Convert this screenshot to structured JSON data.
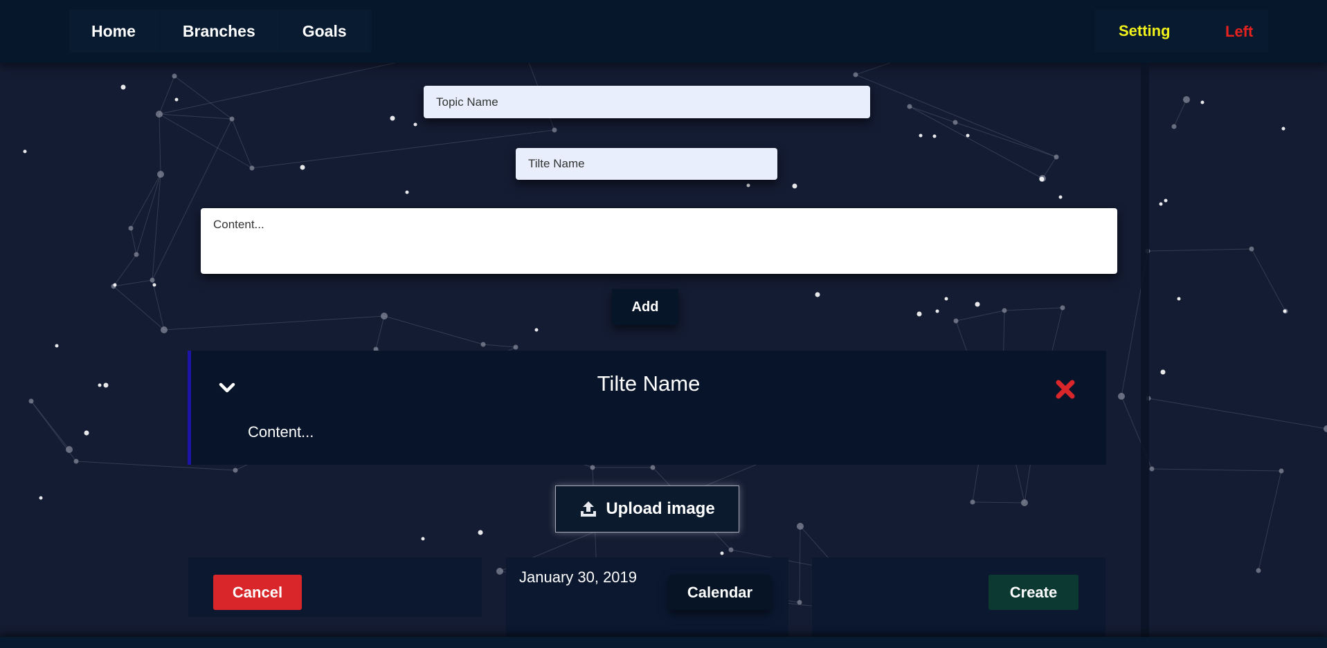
{
  "nav": {
    "items": [
      {
        "label": "Home"
      },
      {
        "label": "Branches"
      },
      {
        "label": "Goals"
      }
    ],
    "setting_label": "Setting",
    "left_label": "Left"
  },
  "form": {
    "topic_placeholder": "Topic Name",
    "title_placeholder": "Tilte Name",
    "content_placeholder": "Content...",
    "add_label": "Add"
  },
  "card": {
    "title": "Tilte Name",
    "content": "Content..."
  },
  "upload_label": "Upload image",
  "footer": {
    "cancel_label": "Cancel",
    "date": "January 30, 2019",
    "calendar_label": "Calendar",
    "create_label": "Create"
  },
  "colors": {
    "background": "#141c33",
    "nav_bg": "#06162b",
    "setting": "#f2f21a",
    "left": "#e8221f",
    "cancel": "#d9262a",
    "create": "#0c3a33",
    "card_accent": "#1d14a8"
  },
  "icons": {
    "chevron": "chevron-down-icon",
    "delete": "close-x-icon",
    "upload": "upload-icon"
  }
}
